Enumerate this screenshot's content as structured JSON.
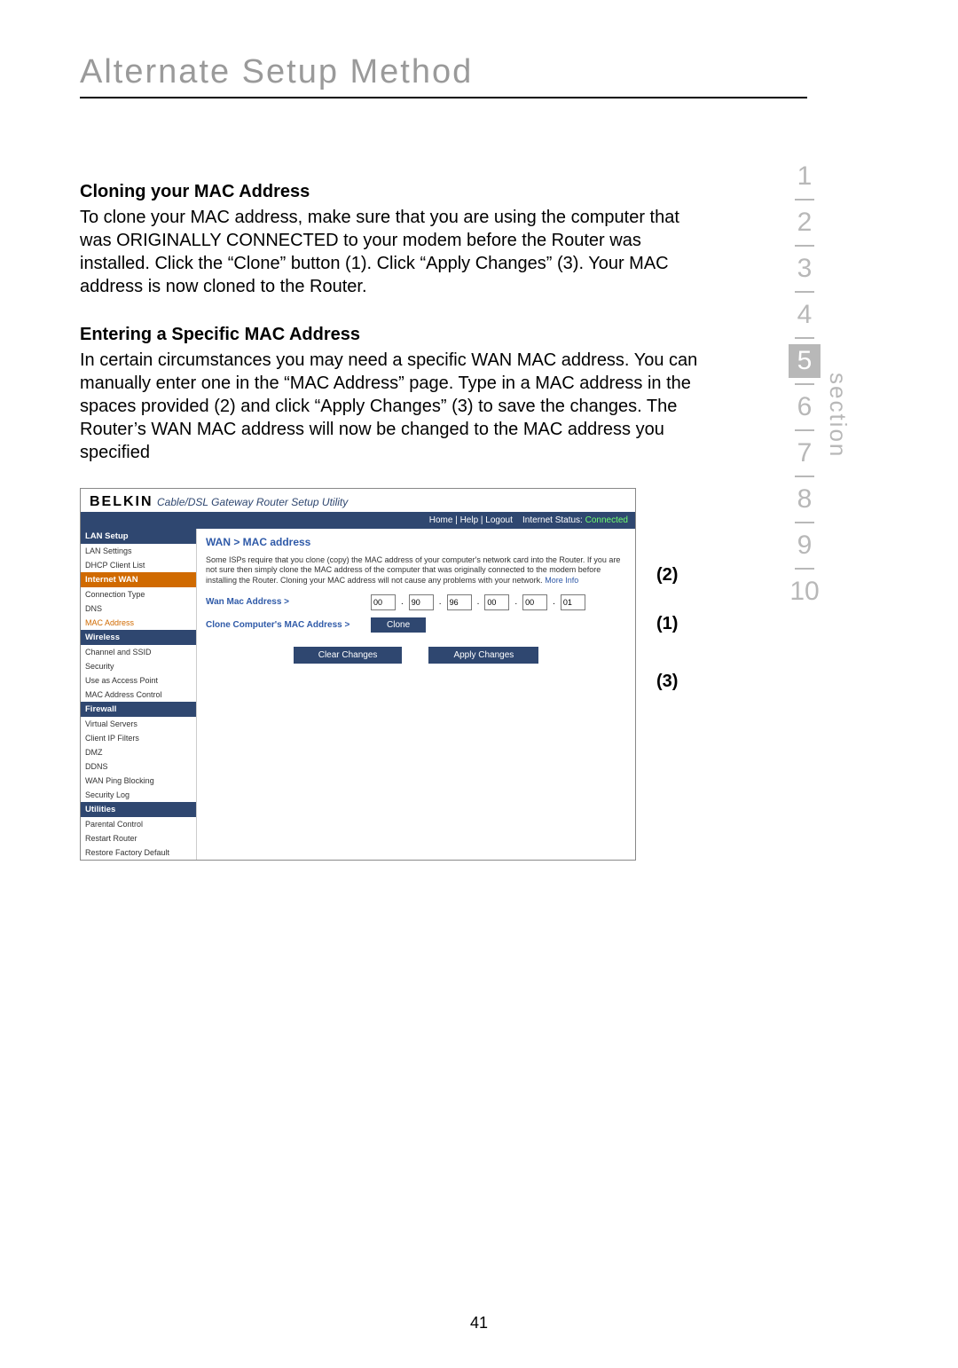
{
  "chapter_title": "Alternate Setup Method",
  "section_word": "section",
  "section_numbers": [
    "1",
    "2",
    "3",
    "4",
    "5",
    "6",
    "7",
    "8",
    "9",
    "10"
  ],
  "current_section": "5",
  "heading_clone": "Cloning your MAC Address",
  "para_clone": "To clone your MAC address, make sure that you are using the computer that was ORIGINALLY CONNECTED to your modem before the Router was installed. Click the “Clone” button (1). Click “Apply Changes” (3). Your MAC address is now cloned to the Router.",
  "heading_specific": "Entering a Specific MAC Address",
  "para_specific": "In certain circumstances you may need a specific WAN MAC address. You can manually enter one in the “MAC Address” page. Type in a MAC address in the spaces provided (2) and click “Apply Changes” (3) to save the changes. The Router’s WAN MAC address will now be changed to the MAC address you specified",
  "callouts": {
    "one": "(1)",
    "two": "(2)",
    "three": "(3)"
  },
  "page_number": "41",
  "shot": {
    "brand": "BELKIN",
    "brand_sub": "Cable/DSL Gateway Router Setup Utility",
    "topbar_links": "Home | Help | Logout",
    "status_label": "Internet Status:",
    "status_value": "Connected",
    "nav": {
      "h1": "LAN Setup",
      "i1": "LAN Settings",
      "i2": "DHCP Client List",
      "h2": "Internet WAN",
      "i3": "Connection Type",
      "i4": "DNS",
      "i5": "MAC Address",
      "h3": "Wireless",
      "i6": "Channel and SSID",
      "i7": "Security",
      "i8": "Use as Access Point",
      "i9": "MAC Address Control",
      "h4": "Firewall",
      "i10": "Virtual Servers",
      "i11": "Client IP Filters",
      "i12": "DMZ",
      "i13": "DDNS",
      "i14": "WAN Ping Blocking",
      "i15": "Security Log",
      "h5": "Utilities",
      "i16": "Parental Control",
      "i17": "Restart Router",
      "i18": "Restore Factory Default"
    },
    "breadcrumb": "WAN > MAC address",
    "desc_text": "Some ISPs require that you clone (copy) the MAC address of your computer's network card into the Router. If you are not sure then simply clone the MAC address of the computer that was originally connected to the modem before installing the Router. Cloning your MAC address will not cause any problems with your network.",
    "more_info": "More Info",
    "wan_label": "Wan Mac Address >",
    "mac": [
      "00",
      "90",
      "96",
      "00",
      "00",
      "01"
    ],
    "clone_label": "Clone Computer's MAC Address >",
    "btn_clone": "Clone",
    "btn_clear": "Clear Changes",
    "btn_apply": "Apply Changes"
  }
}
